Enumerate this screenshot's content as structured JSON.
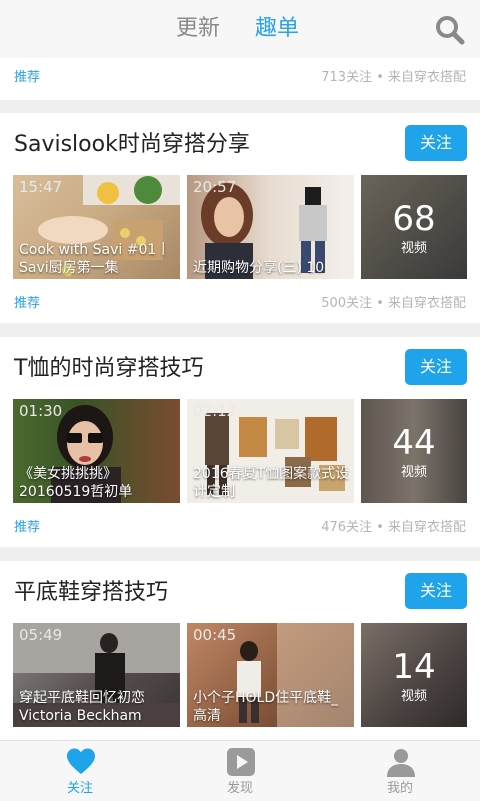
{
  "header": {
    "tabs": [
      {
        "label": "更新",
        "active": false
      },
      {
        "label": "趣单",
        "active": true
      }
    ],
    "search_icon": "search-icon"
  },
  "top_meta": {
    "left": "推荐",
    "right": "713关注 • 来自穿衣搭配"
  },
  "colors": {
    "accent": "#1fa3ea",
    "title": "#222222",
    "meta": "#b5b5b5"
  },
  "cards": [
    {
      "title": "Savislook时尚穿搭分享",
      "follow": "关注",
      "videos": [
        {
          "duration": "15:47",
          "caption": "Cook with Savi #01丨Savi厨房第一集"
        },
        {
          "duration": "20:57",
          "caption": "近期购物分享(三) 10"
        }
      ],
      "count": {
        "number": "68",
        "label": "视频"
      },
      "meta_left": "推荐",
      "meta_right": "500关注 • 来自穿衣搭配"
    },
    {
      "title": "T恤的时尚穿搭技巧",
      "follow": "关注",
      "videos": [
        {
          "duration": "01:30",
          "caption": "《美女挑挑挑》20160519哲初单"
        },
        {
          "duration": "02:12",
          "caption": "2016春夏T恤图案款式设计定制"
        }
      ],
      "count": {
        "number": "44",
        "label": "视频"
      },
      "meta_left": "推荐",
      "meta_right": "476关注 • 来自穿衣搭配"
    },
    {
      "title": "平底鞋穿搭技巧",
      "follow": "关注",
      "videos": [
        {
          "duration": "05:49",
          "caption": "穿起平底鞋回忆初恋Victoria Beckham"
        },
        {
          "duration": "00:45",
          "caption": "小个子HOLD住平底鞋_高清"
        }
      ],
      "count": {
        "number": "14",
        "label": "视频"
      }
    }
  ],
  "bottom_nav": [
    {
      "label": "关注",
      "icon": "heart-icon",
      "active": true
    },
    {
      "label": "发现",
      "icon": "play-icon",
      "active": false
    },
    {
      "label": "我的",
      "icon": "user-icon",
      "active": false
    }
  ]
}
